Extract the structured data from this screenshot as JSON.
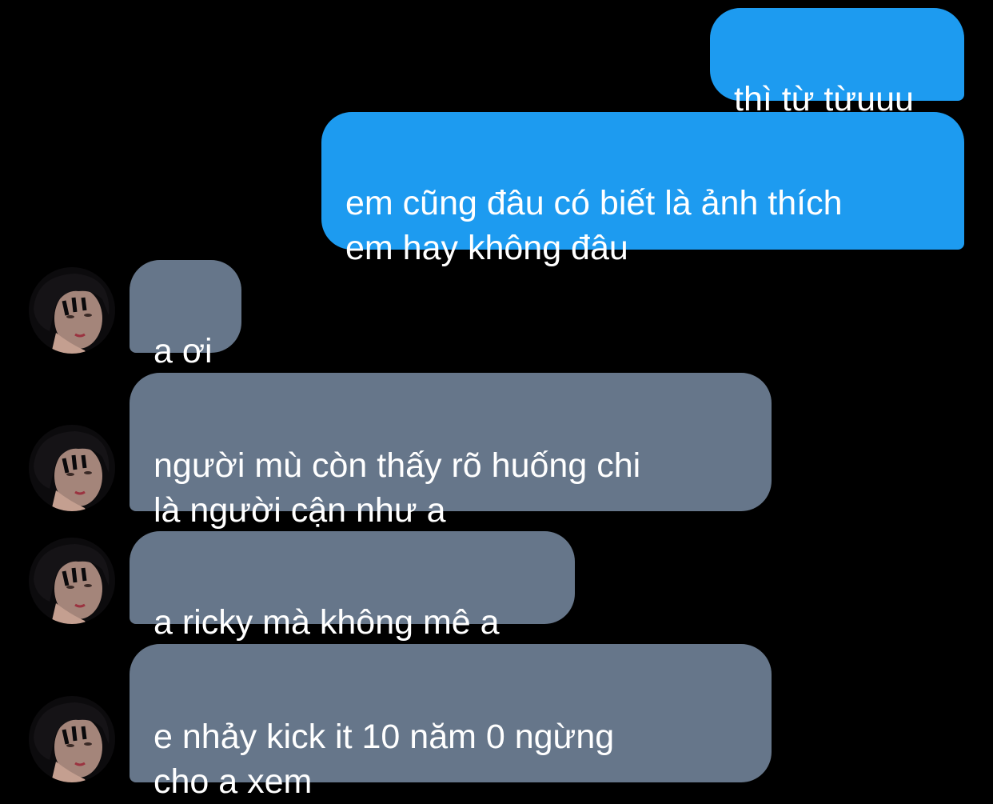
{
  "conversation": {
    "colors": {
      "background": "#000000",
      "sent_bubble": "#1d9bf0",
      "received_bubble": "#66768a",
      "text": "#ffffff"
    },
    "messages": [
      {
        "sender": "me",
        "text": "thì từ từuuu"
      },
      {
        "sender": "me",
        "text": "em cũng đâu có biết là ảnh thích\nem hay không đâu"
      },
      {
        "sender": "them",
        "text": "a ơi"
      },
      {
        "sender": "them",
        "text": "người mù còn thấy rõ huống chi\nlà người cận như a"
      },
      {
        "sender": "them",
        "text": "a ricky mà không mê a"
      },
      {
        "sender": "them",
        "text": "e nhảy kick it 10 năm 0 ngừng\ncho a xem"
      }
    ],
    "avatar_icon": "user-avatar-photo"
  }
}
